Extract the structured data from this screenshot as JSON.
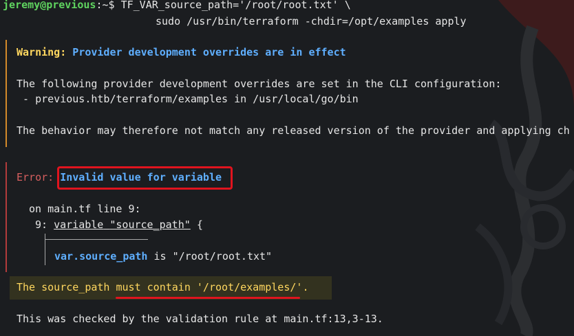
{
  "prompt": {
    "user_host": "jeremy@previous",
    "path": ":~$",
    "command_line1": " TF_VAR_source_path='/root/root.txt' \\",
    "command_line2": "sudo /usr/bin/terraform -chdir=/opt/examples apply"
  },
  "warning": {
    "label": "Warning:",
    "title": "Provider development overrides are in effect",
    "line1": "The following provider development overrides are set in the CLI configuration:",
    "line2": " - previous.htb/terraform/examples in /usr/local/go/bin",
    "line3": "The behavior may therefore not match any released version of the provider and applying ch"
  },
  "error": {
    "label": "Error:",
    "title": "Invalid value for variable",
    "location": "on main.tf line 9:",
    "line_no": "9:",
    "code_variable": "variable",
    "code_name": "\"source_path\"",
    "code_brace": "{",
    "var_ref": "var.source_path",
    "var_is": "is",
    "var_value": "\"/root/root.txt\"",
    "message_prefix": "The source_path",
    "message_highlight": "must contain '/root/examples/'",
    "message_suffix": ".",
    "checked": "This was checked by the validation rule at main.tf:13,3-13."
  }
}
